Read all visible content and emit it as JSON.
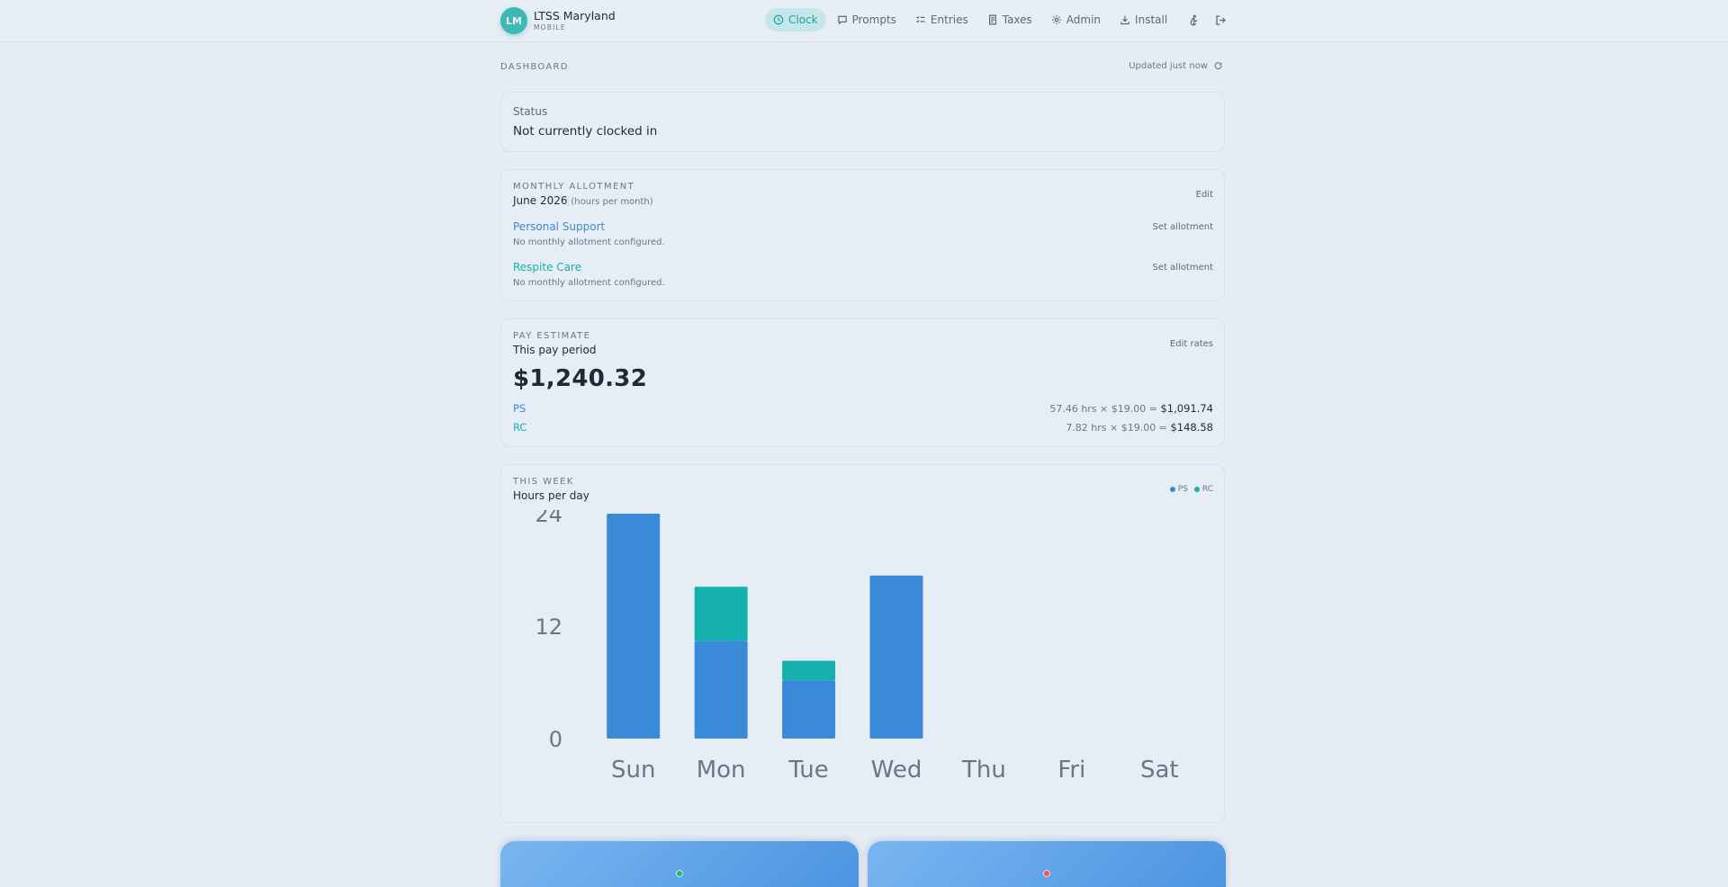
{
  "brand": {
    "initials": "LM",
    "name": "LTSS Maryland",
    "sub": "MOBILE"
  },
  "nav": {
    "items": [
      {
        "label": "Clock",
        "icon": "clock-icon",
        "active": true
      },
      {
        "label": "Prompts",
        "icon": "chat-icon",
        "active": false
      },
      {
        "label": "Entries",
        "icon": "list-check-icon",
        "active": false
      },
      {
        "label": "Taxes",
        "icon": "receipt-icon",
        "active": false
      },
      {
        "label": "Admin",
        "icon": "gear-icon",
        "active": false
      },
      {
        "label": "Install",
        "icon": "download-icon",
        "active": false
      }
    ],
    "extra_icons": [
      "accessibility-icon",
      "logout-icon"
    ]
  },
  "header": {
    "section": "DASHBOARD",
    "updated": "Updated just now"
  },
  "status": {
    "label": "Status",
    "value": "Not currently clocked in"
  },
  "allotment": {
    "kicker": "MONTHLY ALLOTMENT",
    "month": "June 2026",
    "unit_note": "(hours per month)",
    "edit_label": "Edit",
    "rows": [
      {
        "name": "Personal Support",
        "note": "No monthly allotment configured.",
        "action": "Set allotment",
        "color": "#3b8ad8"
      },
      {
        "name": "Respite Care",
        "note": "No monthly allotment configured.",
        "action": "Set allotment",
        "color": "#14b1ad"
      }
    ]
  },
  "pay": {
    "kicker": "PAY ESTIMATE",
    "period": "This pay period",
    "edit_label": "Edit rates",
    "total": "$1,240.32",
    "lines": [
      {
        "code": "PS",
        "formula": "57.46 hrs × $19.00 = ",
        "amount": "$1,091.74"
      },
      {
        "code": "RC",
        "formula": "7.82 hrs × $19.00 = ",
        "amount": "$148.58"
      }
    ]
  },
  "week": {
    "kicker": "THIS WEEK",
    "title": "Hours per day",
    "legend": [
      {
        "name": "PS",
        "color": "#3b8ad8"
      },
      {
        "name": "RC",
        "color": "#14b1ad"
      }
    ]
  },
  "chart_data": {
    "type": "bar",
    "stacked": true,
    "categories": [
      "Sun",
      "Mon",
      "Tue",
      "Wed",
      "Thu",
      "Fri",
      "Sat"
    ],
    "series": [
      {
        "name": "PS",
        "color": "#3b8ad8",
        "values": [
          24,
          10.4,
          6.2,
          17.4,
          0,
          0,
          0
        ]
      },
      {
        "name": "RC",
        "color": "#14b1ad",
        "values": [
          0,
          5.8,
          2.1,
          0,
          0,
          0,
          0
        ]
      }
    ],
    "yticks": [
      0,
      12,
      24
    ],
    "ylim": [
      0,
      24
    ],
    "grid": false,
    "legend": "top-right"
  },
  "tiles": [
    {
      "dot_color": "#22b573"
    },
    {
      "dot_color": "#f0575a"
    }
  ]
}
